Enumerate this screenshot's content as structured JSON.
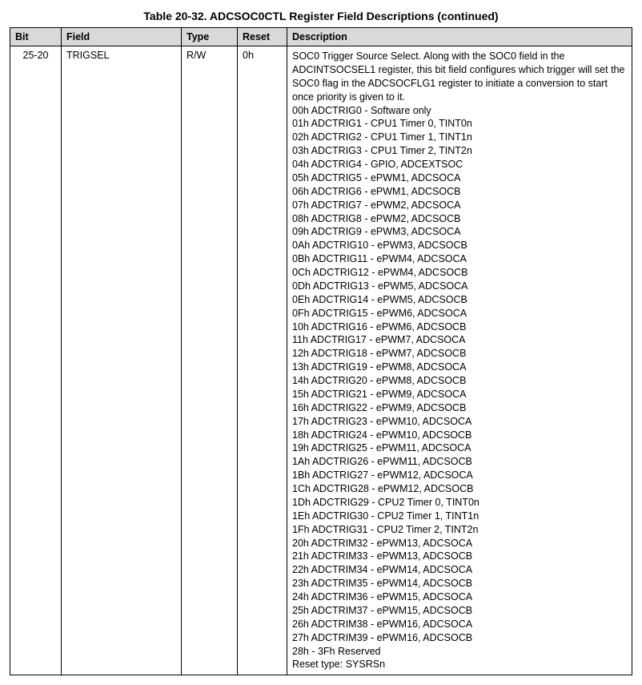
{
  "title": "Table 20-32. ADCSOC0CTL Register Field Descriptions (continued)",
  "headers": {
    "bit": "Bit",
    "field": "Field",
    "type": "Type",
    "reset": "Reset",
    "description": "Description"
  },
  "row": {
    "bit": "25-20",
    "field": "TRIGSEL",
    "type": "R/W",
    "reset": "0h",
    "description": "SOC0 Trigger Source Select. Along with the SOC0 field in the ADCINTSOCSEL1 register, this bit field configures which trigger will set the SOC0 flag in the ADCSOCFLG1 register to initiate a conversion to start once priority is given to it.\n00h ADCTRIG0 - Software only\n01h ADCTRIG1 - CPU1 Timer 0, TINT0n\n02h ADCTRIG2 - CPU1 Timer 1, TINT1n\n03h ADCTRIG3 - CPU1 Timer 2, TINT2n\n04h ADCTRIG4 - GPIO, ADCEXTSOC\n05h ADCTRIG5 - ePWM1, ADCSOCA\n06h ADCTRIG6 - ePWM1, ADCSOCB\n07h ADCTRIG7 - ePWM2, ADCSOCA\n08h ADCTRIG8 - ePWM2, ADCSOCB\n09h ADCTRIG9 - ePWM3, ADCSOCA\n0Ah ADCTRIG10 - ePWM3, ADCSOCB\n0Bh ADCTRIG11 - ePWM4, ADCSOCA\n0Ch ADCTRIG12 - ePWM4, ADCSOCB\n0Dh ADCTRIG13 - ePWM5, ADCSOCA\n0Eh ADCTRIG14 - ePWM5, ADCSOCB\n0Fh ADCTRIG15 - ePWM6, ADCSOCA\n10h ADCTRIG16 - ePWM6, ADCSOCB\n11h ADCTRIG17 - ePWM7, ADCSOCA\n12h ADCTRIG18 - ePWM7, ADCSOCB\n13h ADCTRIG19 - ePWM8, ADCSOCA\n14h ADCTRIG20 - ePWM8, ADCSOCB\n15h ADCTRIG21 - ePWM9, ADCSOCA\n16h ADCTRIG22 - ePWM9, ADCSOCB\n17h ADCTRIG23 - ePWM10, ADCSOCA\n18h ADCTRIG24 - ePWM10, ADCSOCB\n19h ADCTRIG25 - ePWM11, ADCSOCA\n1Ah ADCTRIG26 - ePWM11, ADCSOCB\n1Bh ADCTRIG27 - ePWM12, ADCSOCA\n1Ch ADCTRIG28 - ePWM12, ADCSOCB\n1Dh ADCTRIG29 - CPU2 Timer 0, TINT0n\n1Eh ADCTRIG30 - CPU2 Timer 1, TINT1n\n1Fh ADCTRIG31 - CPU2 Timer 2, TINT2n\n20h ADCTRIM32 - ePWM13, ADCSOCA\n21h ADCTRIM33 - ePWM13, ADCSOCB\n22h ADCTRIM34 - ePWM14, ADCSOCA\n23h ADCTRIM35 - ePWM14, ADCSOCB\n24h ADCTRIM36 - ePWM15, ADCSOCA\n25h ADCTRIM37 - ePWM15, ADCSOCB\n26h ADCTRIM38 - ePWM16, ADCSOCA\n27h ADCTRIM39 - ePWM16, ADCSOCB\n28h - 3Fh Reserved\nReset type: SYSRSn"
  }
}
